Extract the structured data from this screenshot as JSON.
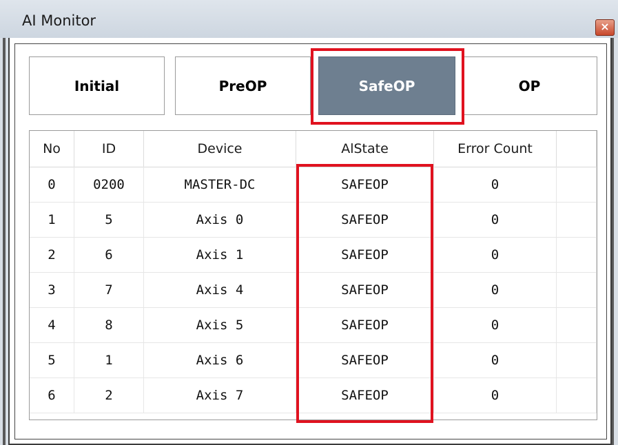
{
  "window": {
    "title": "AI Monitor",
    "close_glyph": "×"
  },
  "states": [
    {
      "label": "Initial",
      "selected": false
    },
    {
      "label": "PreOP",
      "selected": false
    },
    {
      "label": "SafeOP",
      "selected": true
    },
    {
      "label": "OP",
      "selected": false
    }
  ],
  "table": {
    "headers": [
      "No",
      "ID",
      "Device",
      "AlState",
      "Error Count"
    ],
    "rows": [
      [
        "0",
        "0200",
        "MASTER-DC",
        "SAFEOP",
        "0"
      ],
      [
        "1",
        "5",
        "Axis 0",
        "SAFEOP",
        "0"
      ],
      [
        "2",
        "6",
        "Axis 1",
        "SAFEOP",
        "0"
      ],
      [
        "3",
        "7",
        "Axis 4",
        "SAFEOP",
        "0"
      ],
      [
        "4",
        "8",
        "Axis 5",
        "SAFEOP",
        "0"
      ],
      [
        "5",
        "1",
        "Axis 6",
        "SAFEOP",
        "0"
      ],
      [
        "6",
        "2",
        "Axis 7",
        "SAFEOP",
        "0"
      ]
    ]
  },
  "colors": {
    "selected_button_bg": "#6e7f90",
    "highlight": "#e0121f"
  }
}
